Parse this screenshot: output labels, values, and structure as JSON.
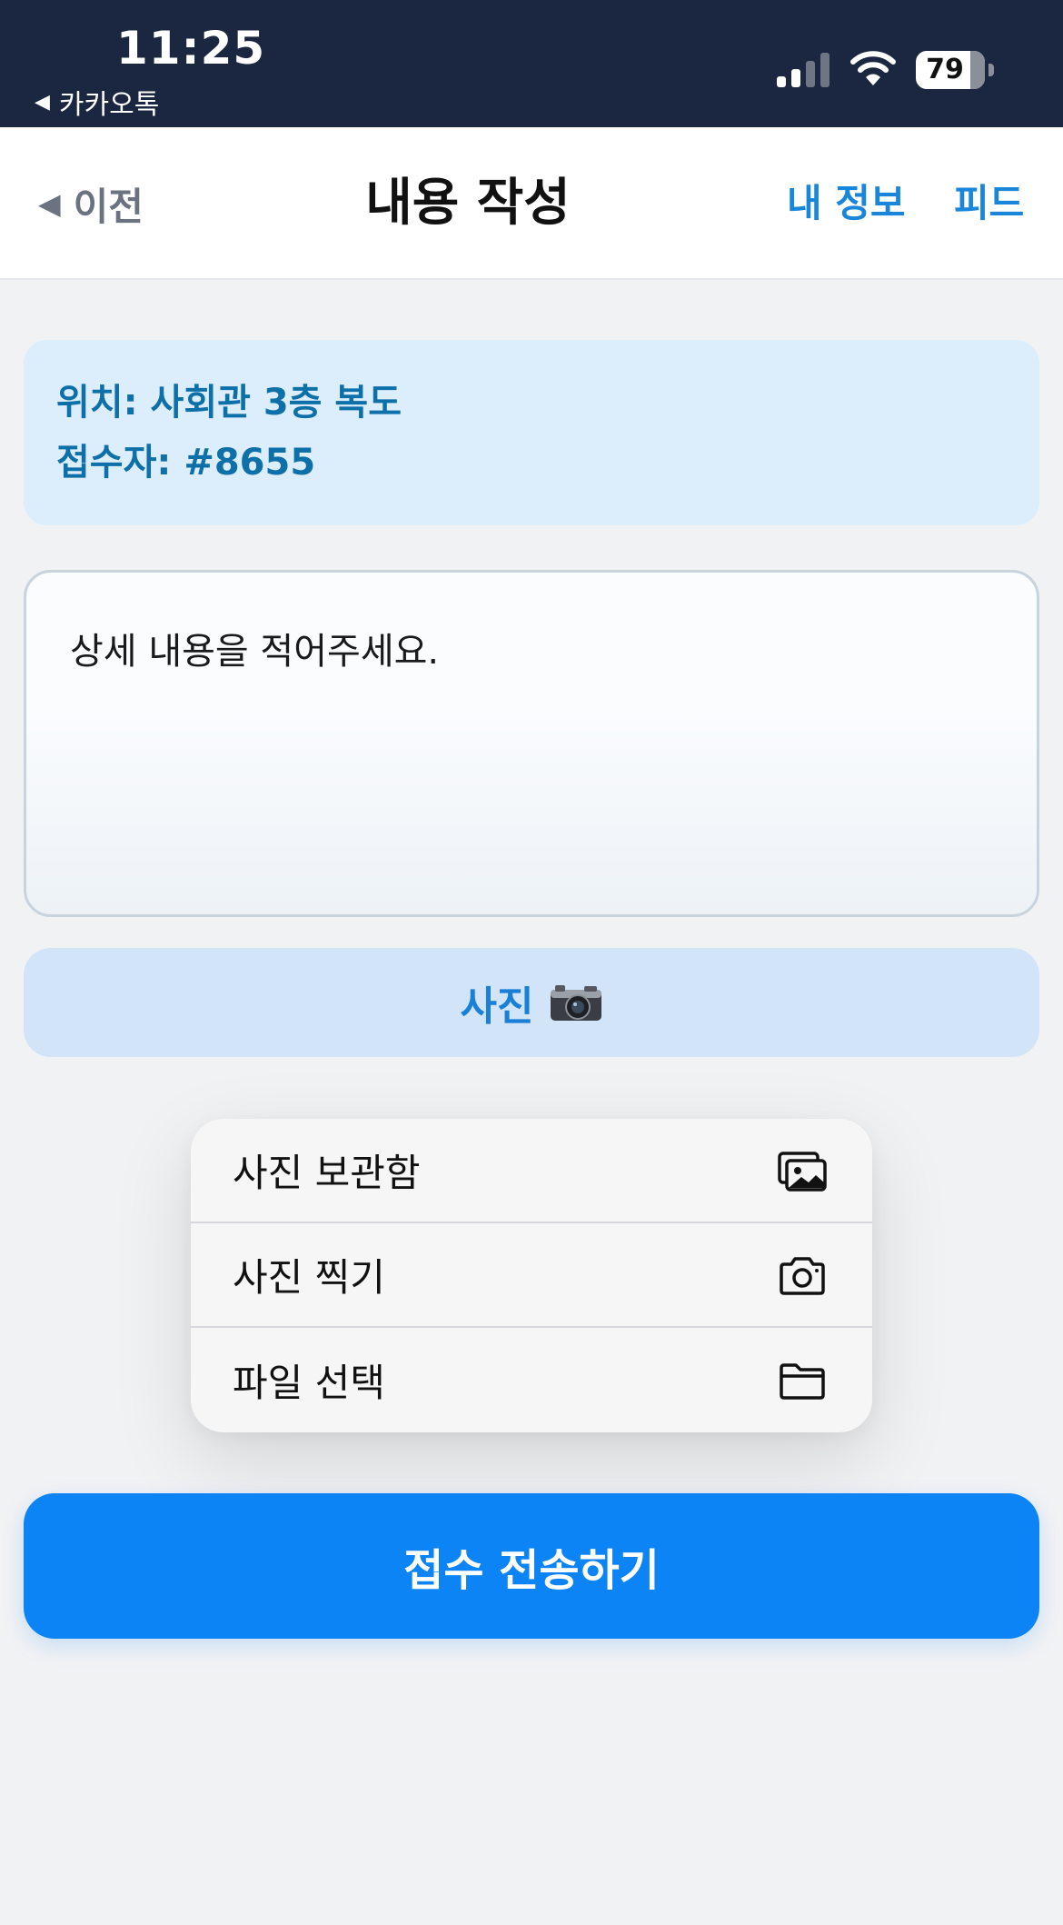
{
  "status_bar": {
    "time": "11:25",
    "back_app": "카카오톡",
    "battery": "79",
    "battery_level": 0.79
  },
  "nav": {
    "back_label": "이전",
    "title": "내용 작성",
    "my_info": "내 정보",
    "feed": "피드"
  },
  "info": {
    "location": "위치: 사회관 3층 복도",
    "receiver": "접수자: #8655"
  },
  "detail": {
    "placeholder": "상세 내용을 적어주세요."
  },
  "photo_button": {
    "label": "사진",
    "icon": "camera-icon"
  },
  "photo_menu": {
    "items": [
      {
        "label": "사진 보관함",
        "icon": "photo-library-icon"
      },
      {
        "label": "사진 찍기",
        "icon": "camera-outline-icon"
      },
      {
        "label": "파일 선택",
        "icon": "folder-icon"
      }
    ]
  },
  "submit": {
    "label": "접수 전송하기"
  },
  "colors": {
    "status_bg": "#1b2740",
    "accent": "#0c84f5",
    "link": "#1a86d9",
    "info_bg": "#dcedfc",
    "info_text": "#0e70a8"
  }
}
